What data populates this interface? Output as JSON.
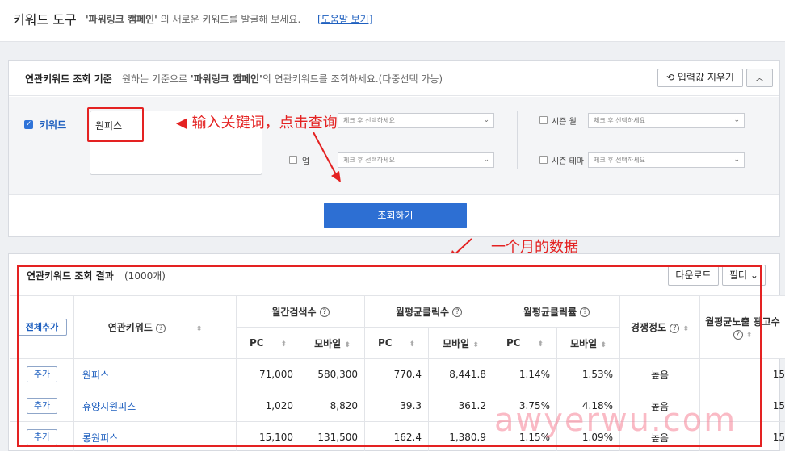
{
  "header": {
    "title": "키워드 도구",
    "subtitle_campaign": "'파워링크 캠페인'",
    "subtitle_rest": "의 새로운 키워드를 발굴해 보세요.",
    "help_link": "[도움말 보기]"
  },
  "criteria": {
    "title": "연관키워드 조회 기준",
    "desc_before": "원하는 기준으로",
    "desc_campaign": "'파워링크 캠페인'",
    "desc_after": "의 연관키워드를 조회하세요.(다중선택 가능)",
    "reset_button": "입력값 지우기",
    "keyword_label": "키워드",
    "keyword_value": "원피스",
    "filter1_placeholder": "체크 후 선택하세요",
    "filter2_label": "업",
    "filter2_placeholder": "체크 후 선택하세요",
    "season_month_label": "시즌 월",
    "season_month_placeholder": "체크 후 선택하세요",
    "season_theme_label": "시즌 테마",
    "season_theme_placeholder": "체크 후 선택하세요",
    "query_button": "조회하기"
  },
  "annotations": {
    "enter_keyword": "输入关键词，点击查询",
    "one_month": "一个月的数据"
  },
  "results": {
    "title": "연관키워드 조회 결과",
    "count": "(1000개)",
    "download_button": "다운로드",
    "filter_button": "필터",
    "add_all_button": "전체추가",
    "headers": {
      "keyword": "연관키워드",
      "monthly_search": "월간검색수",
      "avg_clicks": "월평균클릭수",
      "avg_ctr": "월평균클릭률",
      "competition": "경쟁정도",
      "avg_ads": "월평균노출 광고수",
      "pc": "PC",
      "mobile": "모바일"
    },
    "add_label": "추가",
    "rows": [
      {
        "keyword": "원피스",
        "search_pc": "71,000",
        "search_mobile": "580,300",
        "clicks_pc": "770.4",
        "clicks_mobile": "8,441.8",
        "ctr_pc": "1.14%",
        "ctr_mobile": "1.53%",
        "competition": "높음",
        "ads": "15"
      },
      {
        "keyword": "휴양지원피스",
        "search_pc": "1,020",
        "search_mobile": "8,820",
        "clicks_pc": "39.3",
        "clicks_mobile": "361.2",
        "ctr_pc": "3.75%",
        "ctr_mobile": "4.18%",
        "competition": "높음",
        "ads": "15"
      },
      {
        "keyword": "롱원피스",
        "search_pc": "15,100",
        "search_mobile": "131,500",
        "clicks_pc": "162.4",
        "clicks_mobile": "1,380.9",
        "ctr_pc": "1.15%",
        "ctr_mobile": "1.09%",
        "competition": "높음",
        "ads": "15"
      }
    ]
  },
  "watermark": "awyerwu.com",
  "colors": {
    "accent": "#2d6fd3",
    "annotation_red": "#e42222",
    "link_blue": "#1e5fbf"
  }
}
